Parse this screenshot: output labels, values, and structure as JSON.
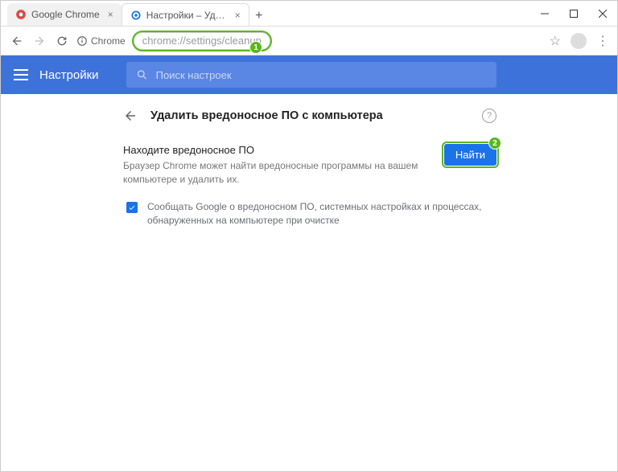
{
  "window": {
    "tabs": [
      {
        "title": "Google Chrome",
        "active": false
      },
      {
        "title": "Настройки – Удалить вредонос",
        "active": true
      }
    ]
  },
  "toolbar": {
    "secure_label": "Chrome",
    "url": "chrome://settings/cleanup"
  },
  "settings_header": {
    "title": "Настройки",
    "search_placeholder": "Поиск настроек"
  },
  "page": {
    "title": "Удалить вредоносное ПО с компьютера",
    "section_title": "Находите вредоносное ПО",
    "section_desc": "Браузер Chrome может найти вредоносные программы на вашем компьютере и удалить их.",
    "find_button": "Найти",
    "checkbox_label": "Сообщать Google о вредоносном ПО, системных настройках и процессах, обнаруженных на компьютере при очистке",
    "checkbox_checked": true
  },
  "annotations": {
    "badge1": "1",
    "badge2": "2"
  }
}
